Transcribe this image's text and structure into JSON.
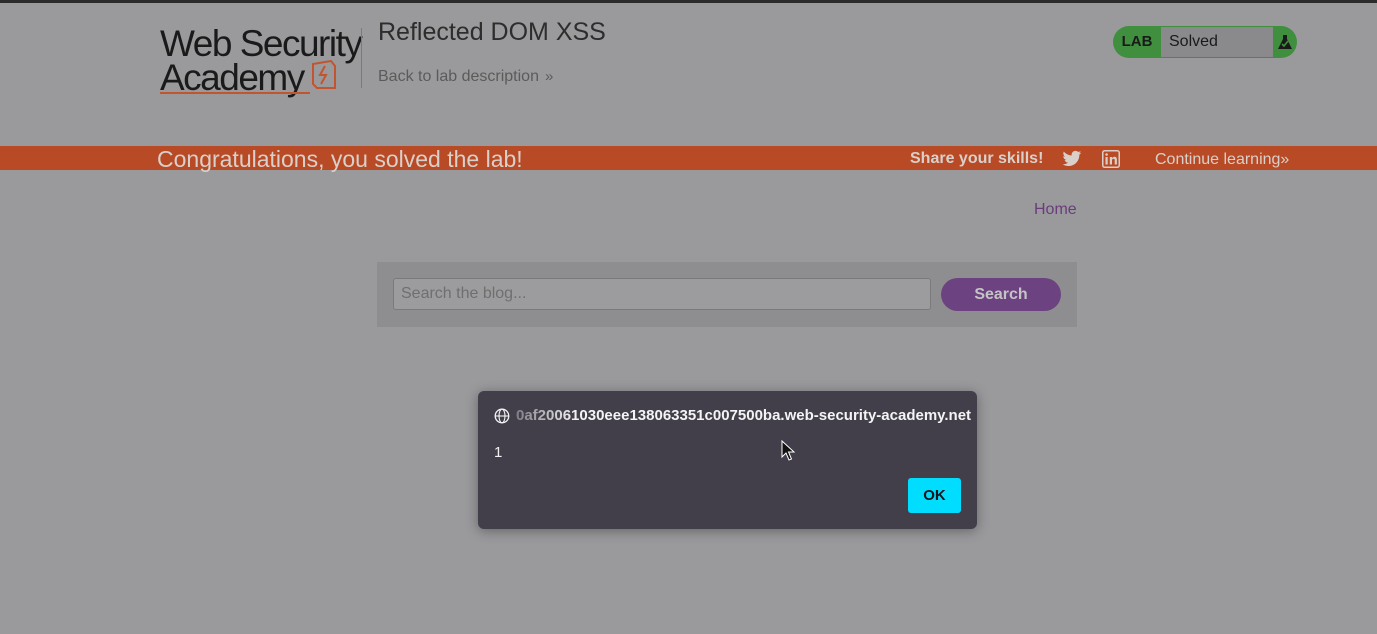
{
  "header": {
    "logo": {
      "line1": "Web Security",
      "line2": "Academy"
    },
    "lab_title": "Reflected DOM XSS",
    "back_link": "Back to lab description",
    "status": {
      "badge": "LAB",
      "state": "Solved",
      "icon": "flask-icon"
    }
  },
  "banner": {
    "message": "Congratulations, you solved the lab!",
    "share_label": "Share your skills!",
    "share_icons": [
      "twitter-icon",
      "linkedin-icon"
    ],
    "continue_label": "Continue learning"
  },
  "nav": {
    "home": "Home"
  },
  "search": {
    "placeholder": "Search the blog...",
    "value": "",
    "button": "Search"
  },
  "dialog": {
    "origin": "0af20061030eee138063351c007500ba.web-security-academy.net",
    "message": "1",
    "ok": "OK"
  },
  "colors": {
    "banner": "#b84b25",
    "status_green": "#3f8f3f",
    "search_button": "#6c4380",
    "ok_button": "#00ddff",
    "dialog_bg": "#423f4b"
  }
}
